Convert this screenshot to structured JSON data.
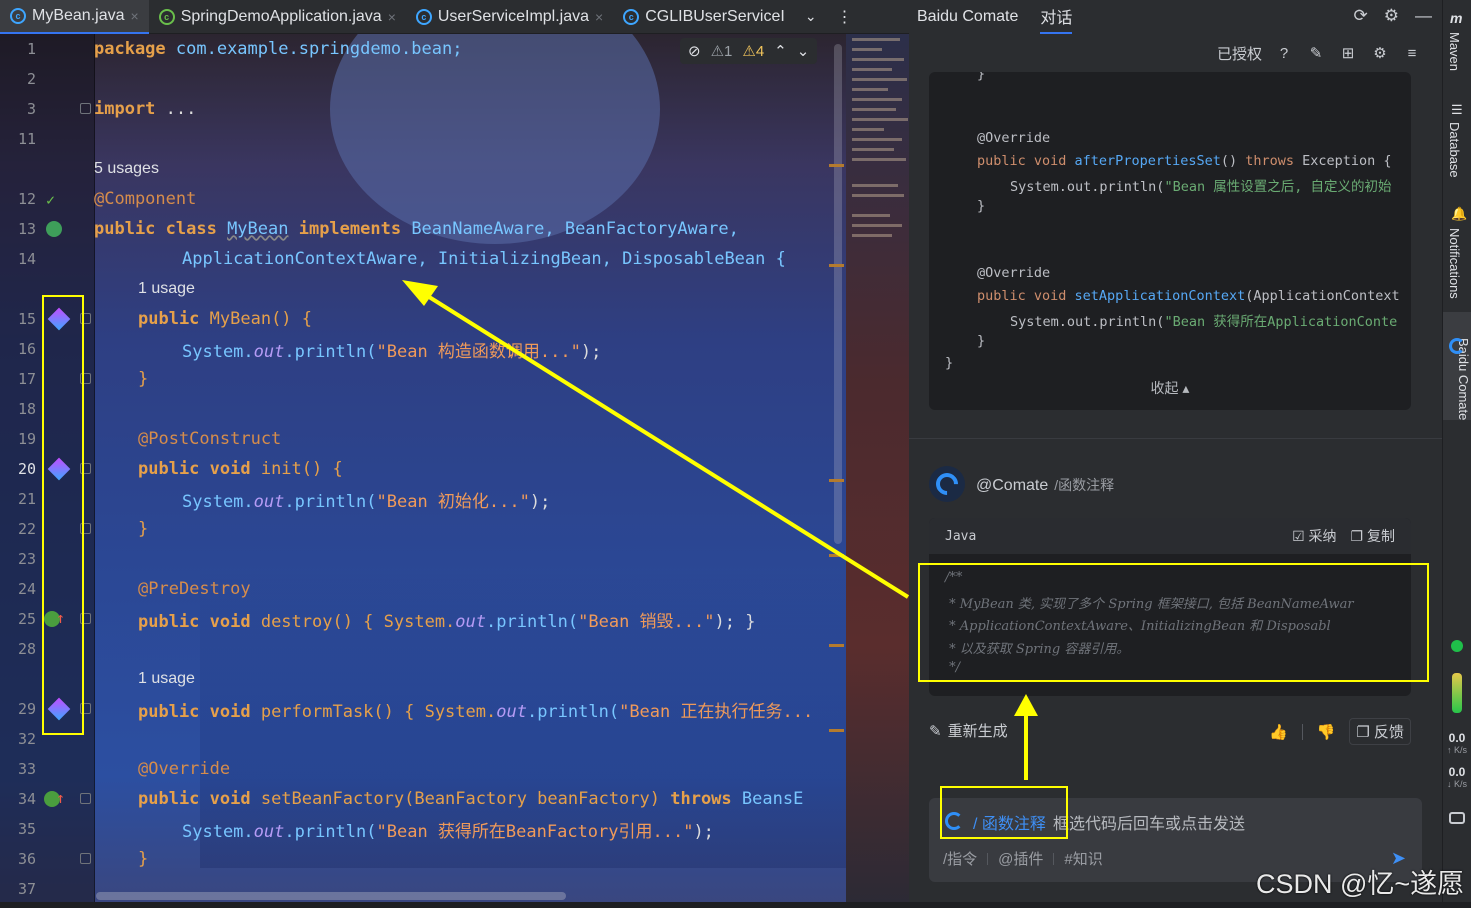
{
  "tabs": [
    {
      "label": "MyBean.java",
      "active": true
    },
    {
      "label": "SpringDemoApplication.java",
      "active": false
    },
    {
      "label": "UserServiceImpl.java",
      "active": false
    },
    {
      "label": "CGLIBUserServiceI",
      "active": false
    }
  ],
  "inspections": {
    "weak": "1",
    "warn": "4"
  },
  "editor": {
    "usages_5": "5 usages",
    "usage_1": "1 usage",
    "usage_1b": "1 usage",
    "lines": {
      "l1": "package com.example.springdemo.bean;",
      "l3": "import ...",
      "l12": "@Component",
      "l13a": "public class ",
      "l13b": "MyBean",
      "l13c": " implements ",
      "l13d": "BeanNameAware, BeanFactoryAware,",
      "l14": "ApplicationContextAware, InitializingBean, DisposableBean {",
      "l15a": "public ",
      "l15b": "MyBean() {",
      "l16a": "System.",
      "l16b": "out",
      "l16c": ".println(",
      "l16d": "\"Bean 构造函数调用...\"",
      "l16e": ");",
      "l17": "}",
      "l19": "@PostConstruct",
      "l20a": "public void ",
      "l20b": "init() {",
      "l21a": "System.",
      "l21b": "out",
      "l21c": ".println(",
      "l21d": "\"Bean 初始化...\"",
      "l21e": ");",
      "l22": "}",
      "l24": "@PreDestroy",
      "l25a": "public void ",
      "l25b": "destroy() { System.",
      "l25c": "out",
      "l25d": ".println(",
      "l25e": "\"Bean 销毁...\"",
      "l25f": "); }",
      "l29a": "public void ",
      "l29b": "performTask() { System.",
      "l29c": "out",
      "l29d": ".println(",
      "l29e": "\"Bean 正在执行任务...",
      "l33": "@Override",
      "l34a": "public void ",
      "l34b": "setBeanFactory(BeanFactory beanFactory) ",
      "l34c": "throws ",
      "l34d": "BeansE",
      "l35a": "System.",
      "l35b": "out",
      "l35c": ".println(",
      "l35d": "\"Bean 获得所在BeanFactory引用...\"",
      "l35e": ");",
      "l36": "}"
    },
    "line_numbers": [
      "1",
      "2",
      "3",
      "11",
      "12",
      "13",
      "14",
      "15",
      "16",
      "17",
      "18",
      "19",
      "20",
      "21",
      "22",
      "23",
      "24",
      "25",
      "28",
      "29",
      "32",
      "33",
      "34",
      "35",
      "36",
      "37"
    ]
  },
  "panel": {
    "title": "Baidu Comate",
    "tab_chat": "对话",
    "authorized": "已授权",
    "code": {
      "c0": "}",
      "c1": "@Override",
      "c2a": "public void ",
      "c2b": "afterPropertiesSet",
      "c2c": "() ",
      "c2d": "throws ",
      "c2e": "Exception {",
      "c3a": "System.out.println(",
      "c3b": "\"Bean 属性设置之后, 自定义的初始",
      "c4": "}",
      "c5": "@Override",
      "c6a": "public void ",
      "c6b": "setApplicationContext",
      "c6c": "(ApplicationContext",
      "c7a": "System.out.println(",
      "c7b": "\"Bean 获得所在ApplicationConte",
      "c8": "}",
      "c9": "}"
    },
    "collapse": "收起 ▴",
    "user_name": "@Comate",
    "user_cmd": "/函数注释",
    "answer_lang": "Java",
    "adopt": "采纳",
    "copy": "复制",
    "answer_lines": [
      "/**",
      " * MyBean 类, 实现了多个 Spring 框架接口, 包括 BeanNameAwar",
      " * ApplicationContextAware、InitializingBean 和 Disposabl",
      " * 以及获取 Spring 容器引用。",
      " */"
    ],
    "regenerate": "重新生成",
    "feedback": "反馈",
    "input_tag": "/ 函数注释",
    "input_placeholder": "框选代码后回车或点击发送",
    "input_cmd": "/指令",
    "input_plugin": "@插件",
    "input_knowledge": "#知识"
  },
  "stripe": {
    "maven": "Maven",
    "database": "Database",
    "notifications": "Notifications",
    "comate": "Baidu Comate",
    "up_val": "0.0",
    "up_unit": "↑ K/s",
    "down_val": "0.0",
    "down_unit": "↓ K/s"
  },
  "watermark": "CSDN @忆~遂愿"
}
